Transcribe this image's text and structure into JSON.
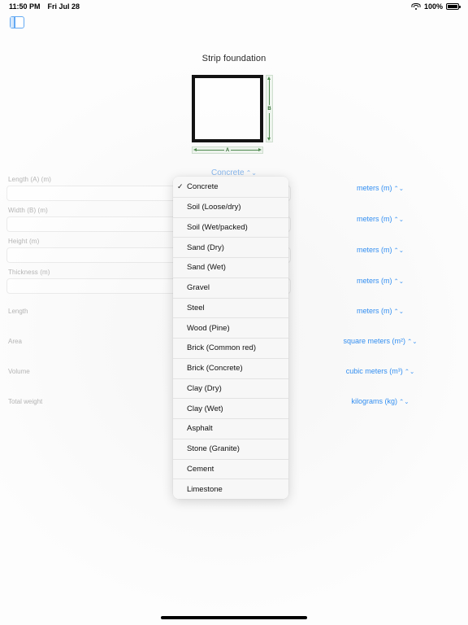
{
  "status_bar": {
    "time": "11:50 PM",
    "date": "Fri Jul 28",
    "battery_percent": "100%",
    "wifi_icon": "wifi-icon",
    "battery_icon": "battery-full-icon"
  },
  "toolbar": {
    "sidebar_toggle_icon": "sidebar-toggle-icon"
  },
  "diagram": {
    "title": "Strip foundation",
    "dim_a_label": "A",
    "dim_b_label": "B",
    "shape_color": "#111111",
    "dimension_color": "#4f8a4f"
  },
  "material_picker": {
    "selected": "Concrete",
    "chevron": "⌃⌄",
    "color": "#89b9f0"
  },
  "form": {
    "fields": [
      {
        "label": "Length (A) (m)",
        "value": "",
        "unit": "meters (m)"
      },
      {
        "label": "Width (B) (m)",
        "value": "",
        "unit": "meters (m)"
      },
      {
        "label": "Height (m)",
        "value": "",
        "unit": "meters (m)"
      },
      {
        "label": "Thickness (m)",
        "value": "",
        "unit": "meters (m)"
      }
    ]
  },
  "results": {
    "rows": [
      {
        "label": "Length",
        "value": "",
        "unit": "meters (m)"
      },
      {
        "label": "Area",
        "value": "",
        "unit": "square meters (m²)"
      },
      {
        "label": "Volume",
        "value": "",
        "unit": "cubic meters (m³)"
      },
      {
        "label": "Total weight",
        "value": "",
        "unit": "kilograms (kg)"
      }
    ]
  },
  "dropdown": {
    "open": true,
    "checkmark": "✓",
    "selected_index": 0,
    "items": [
      "Concrete",
      "Soil (Loose/dry)",
      "Soil (Wet/packed)",
      "Sand (Dry)",
      "Sand (Wet)",
      "Gravel",
      "Steel",
      "Wood (Pine)",
      "Brick (Common red)",
      "Brick (Concrete)",
      "Clay (Dry)",
      "Clay (Wet)",
      "Asphalt",
      "Stone (Granite)",
      "Cement",
      "Limestone"
    ]
  },
  "chevron_glyph": "⌃⌄",
  "accent_color": "#2f8ef4"
}
